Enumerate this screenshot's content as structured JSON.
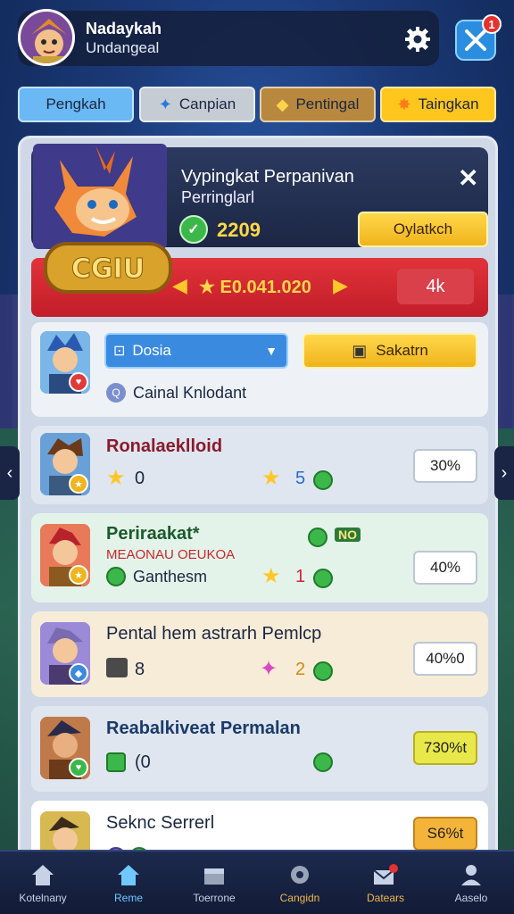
{
  "header": {
    "player_name": "Nadaykah",
    "player_sub": "Undangeal",
    "notif_count": "1"
  },
  "tabs": [
    {
      "label": "Pengkah",
      "icon": "none",
      "bg": "#6ab8f4"
    },
    {
      "label": "Canpian",
      "icon": "puzzle-icon",
      "bg": "#c6ccd4"
    },
    {
      "label": "Pentingal",
      "icon": "tag-icon",
      "bg": "#b8883e"
    },
    {
      "label": "Taingkan",
      "icon": "star-burst-icon",
      "bg": "#ffc61e"
    }
  ],
  "featured": {
    "title": "Vypingkat Perpanivan",
    "subtitle": "Perringlarl",
    "score": "2209",
    "button": "Oylatkch",
    "emblem_text": "CGIU",
    "reward_amount": "E0.041.020",
    "reward_count": "4k"
  },
  "search_card": {
    "dropdown_value": "Dosia",
    "button": "Sakatrn",
    "note": "Cainal Knlodant"
  },
  "rows": [
    {
      "name": "Ronalaeklloid",
      "stat_left": "0",
      "stat_right": "5",
      "value": "30%",
      "value_bg": "#ffffff"
    },
    {
      "name": "Periraakat*",
      "subname": "MEAONAU OEUKOA",
      "tag": "NO",
      "stat_left": "Ganthesm",
      "stat_right": "1",
      "value": "40%",
      "value_bg": "#ffffff"
    },
    {
      "name": "Pental hem astrarh Pemlcp",
      "stat_left": "8",
      "stat_right": "2",
      "value": "40%0",
      "value_bg": "#ffffff"
    },
    {
      "name": "Reabalkiveat Permalan",
      "stat_left": "(0",
      "stat_right": "",
      "value": "730%t",
      "value_bg": "#e8e84a"
    },
    {
      "name": "Seknc Serrerl",
      "stat_left": "",
      "stat_right": "",
      "value": "S6%t",
      "value_bg": "#f4b43a"
    }
  ],
  "bottom_nav": [
    {
      "label": "Kotelnany",
      "icon": "home-icon",
      "color": "#c8d2e6"
    },
    {
      "label": "Reme",
      "icon": "home-active-icon",
      "color": "#6fc8ff"
    },
    {
      "label": "Toerrone",
      "icon": "box-icon",
      "color": "#c8d2e6"
    },
    {
      "label": "Cangidn",
      "icon": "gear-badge-icon",
      "color": "#f0b84a"
    },
    {
      "label": "Datears",
      "icon": "mail-icon",
      "color": "#f0b84a"
    },
    {
      "label": "Aaselo",
      "icon": "user-icon",
      "color": "#c8d2e6"
    }
  ]
}
